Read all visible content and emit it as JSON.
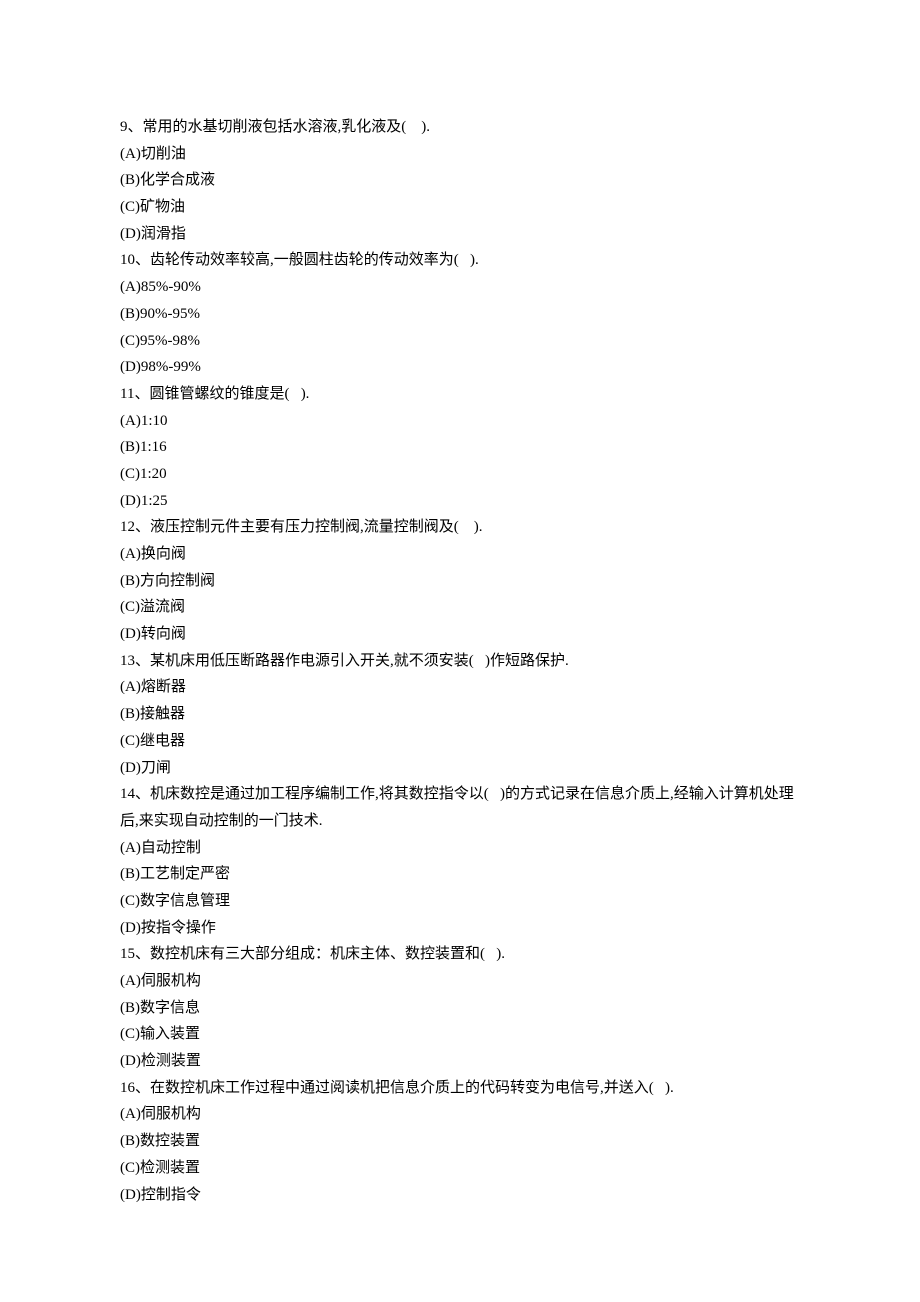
{
  "questions": [
    {
      "prompt": "9、常用的水基切削液包括水溶液,乳化液及(    ).",
      "options": [
        "(A)切削油",
        "(B)化学合成液",
        "(C)矿物油",
        "(D)润滑指"
      ]
    },
    {
      "prompt": "10、齿轮传动效率较高,一般圆柱齿轮的传动效率为(   ).",
      "options": [
        "(A)85%-90%",
        "(B)90%-95%",
        "(C)95%-98%",
        "(D)98%-99%"
      ]
    },
    {
      "prompt": "11、圆锥管螺纹的锥度是(   ).",
      "options": [
        "(A)1:10",
        "(B)1:16",
        "(C)1:20",
        "(D)1:25"
      ]
    },
    {
      "prompt": "12、液压控制元件主要有压力控制阀,流量控制阀及(    ).",
      "options": [
        "(A)换向阀",
        "(B)方向控制阀",
        "(C)溢流阀",
        "(D)转向阀"
      ]
    },
    {
      "prompt": "13、某机床用低压断路器作电源引入开关,就不须安装(   )作短路保护.",
      "options": [
        "(A)熔断器",
        "(B)接触器",
        "(C)继电器",
        "(D)刀闸"
      ]
    },
    {
      "prompt": "14、机床数控是通过加工程序编制工作,将其数控指令以(   )的方式记录在信息介质上,经输入计算机处理后,来实现自动控制的一门技术.",
      "options": [
        "(A)自动控制",
        "(B)工艺制定严密",
        "(C)数字信息管理",
        "(D)按指令操作"
      ]
    },
    {
      "prompt": "15、数控机床有三大部分组成：机床主体、数控装置和(   ).",
      "options": [
        "(A)伺服机构",
        "(B)数字信息",
        "(C)输入装置",
        "(D)检测装置"
      ]
    },
    {
      "prompt": "16、在数控机床工作过程中通过阅读机把信息介质上的代码转变为电信号,并送入(   ).",
      "options": [
        "(A)伺服机构",
        "(B)数控装置",
        "(C)检测装置",
        "(D)控制指令"
      ]
    }
  ]
}
